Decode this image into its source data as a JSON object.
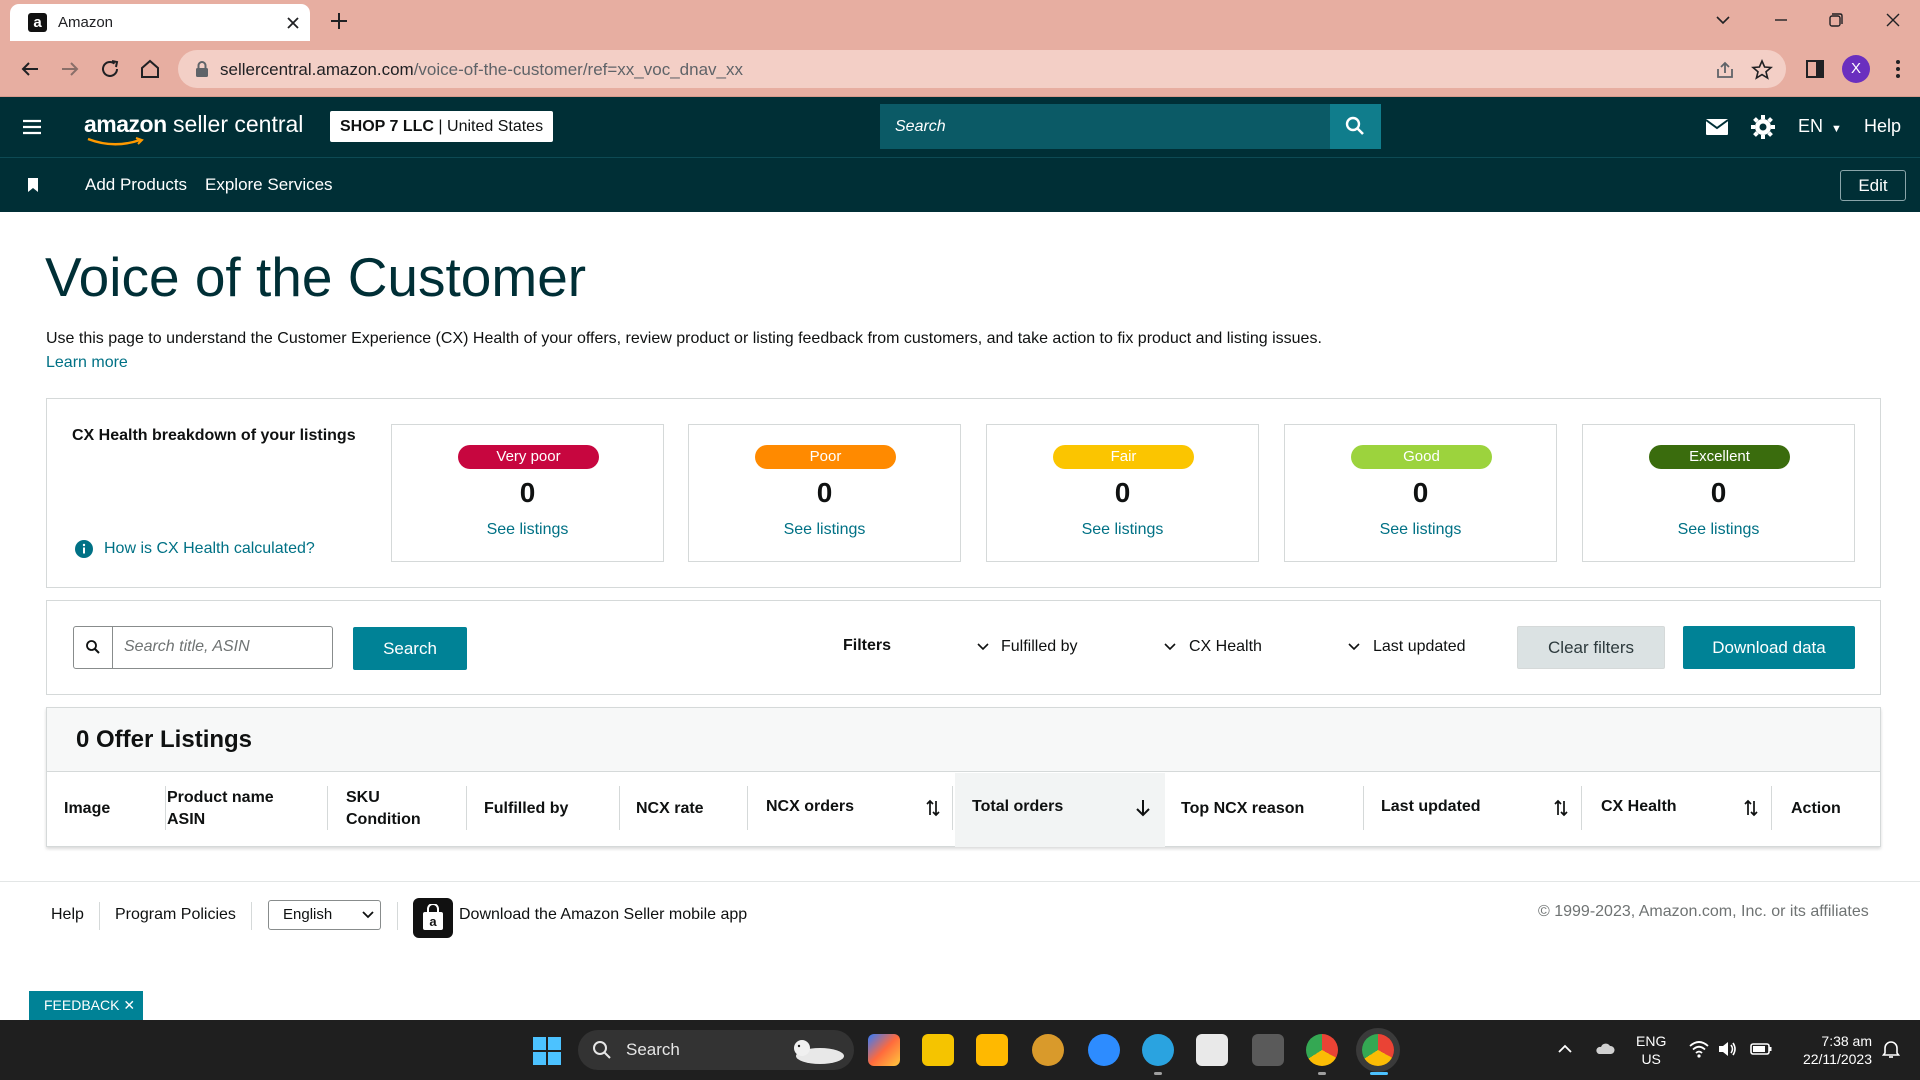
{
  "browser": {
    "tab_title": "Amazon",
    "url_host": "sellercentral.amazon.com",
    "url_path": "/voice-of-the-customer/ref=xx_voc_dnav_xx",
    "profile_initial": "X"
  },
  "header": {
    "brand_prefix": "amazon",
    "brand_suffix": "seller central",
    "account_name": "SHOP 7 LLC",
    "account_sep": "|",
    "account_region": "United States",
    "search_placeholder": "Search",
    "language": "EN",
    "help": "Help"
  },
  "subnav": {
    "links": [
      "Add Products",
      "Explore Services"
    ],
    "edit": "Edit"
  },
  "page": {
    "title": "Voice of the Customer",
    "intro": "Use this page to understand the Customer Experience (CX) Health of your offers, review product or listing feedback from customers, and take action to fix product and listing issues.",
    "learn_more": "Learn more"
  },
  "cx_health": {
    "title": "CX Health breakdown of your listings",
    "info_link": "How is CX Health calculated?",
    "cards": [
      {
        "label": "Very poor",
        "count": "0",
        "link": "See listings",
        "color": "#c7063f"
      },
      {
        "label": "Poor",
        "count": "0",
        "link": "See listings",
        "color": "#ff8a00"
      },
      {
        "label": "Fair",
        "count": "0",
        "link": "See listings",
        "color": "#fbc500"
      },
      {
        "label": "Good",
        "count": "0",
        "link": "See listings",
        "color": "#9cd33d"
      },
      {
        "label": "Excellent",
        "count": "0",
        "link": "See listings",
        "color": "#3a6c0d"
      }
    ]
  },
  "filters": {
    "search_placeholder": "Search title, ASIN",
    "search_button": "Search",
    "label": "Filters",
    "dropdowns": [
      "Fulfilled by",
      "CX Health",
      "Last updated"
    ],
    "clear": "Clear filters",
    "download": "Download data"
  },
  "listings": {
    "title": "0 Offer Listings",
    "columns": [
      {
        "line1": "Image",
        "line2": ""
      },
      {
        "line1": "Product name",
        "line2": "ASIN"
      },
      {
        "line1": "SKU",
        "line2": "Condition"
      },
      {
        "line1": "Fulfilled by",
        "line2": ""
      },
      {
        "line1": "NCX rate",
        "line2": ""
      },
      {
        "line1": "NCX orders",
        "line2": ""
      },
      {
        "line1": "Total orders",
        "line2": ""
      },
      {
        "line1": "Top NCX reason",
        "line2": ""
      },
      {
        "line1": "Last updated",
        "line2": ""
      },
      {
        "line1": "CX Health",
        "line2": ""
      },
      {
        "line1": "Action",
        "line2": ""
      }
    ]
  },
  "footer": {
    "help": "Help",
    "policies": "Program Policies",
    "language": "English",
    "app_link": "Download the Amazon Seller mobile app",
    "copyright": "© 1999-2023, Amazon.com, Inc. or its affiliates",
    "feedback": "FEEDBACK ✕"
  },
  "taskbar": {
    "search": "Search",
    "lang_line1": "ENG",
    "lang_line2": "US",
    "time": "7:38 am",
    "date": "22/11/2023"
  },
  "colors": {
    "header_bg": "#002f36",
    "teal_button": "#008296",
    "link": "#007185",
    "browser_chrome": "#e7aea1"
  }
}
